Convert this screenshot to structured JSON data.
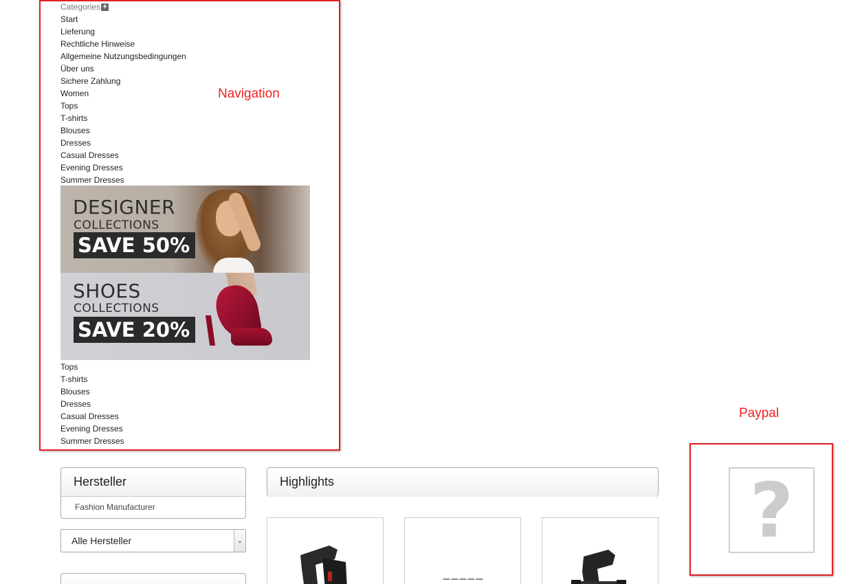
{
  "annotations": {
    "navigation_label": "Navigation",
    "paypal_label": "Paypal"
  },
  "navigation": {
    "header": "Categories",
    "header_icon": "plus-icon",
    "items": [
      "Start",
      "Lieferung",
      "Rechtliche Hinweise",
      "Allgemeine Nutzungsbedingungen",
      "Über uns",
      "Sichere Zahlung",
      "Women",
      "Tops",
      "T-shirts",
      "Blouses",
      "Dresses",
      "Casual Dresses",
      "Evening Dresses",
      "Summer Dresses"
    ],
    "items_after_banners": [
      "Tops",
      "T-shirts",
      "Blouses",
      "Dresses",
      "Casual Dresses",
      "Evening Dresses",
      "Summer Dresses"
    ]
  },
  "banners": [
    {
      "title": "DESIGNER",
      "subtitle": "COLLECTIONS",
      "promo": "SAVE 50%"
    },
    {
      "title": "SHOES",
      "subtitle": "COLLECTIONS",
      "promo": "SAVE 20%"
    }
  ],
  "hersteller": {
    "title": "Hersteller",
    "manufacturer": "Fashion Manufacturer",
    "select_value": "Alle Hersteller"
  },
  "highlights": {
    "title": "Highlights",
    "products": [
      {
        "image": "holster-product-image"
      },
      {
        "image": "brand-logo-image"
      },
      {
        "image": "holster-product-image"
      }
    ]
  },
  "paypal": {
    "placeholder_glyph": "?"
  },
  "colors": {
    "annotation_red": "#e02020",
    "panel_border": "#aaaaaa",
    "placeholder_grey": "#cccccc"
  }
}
